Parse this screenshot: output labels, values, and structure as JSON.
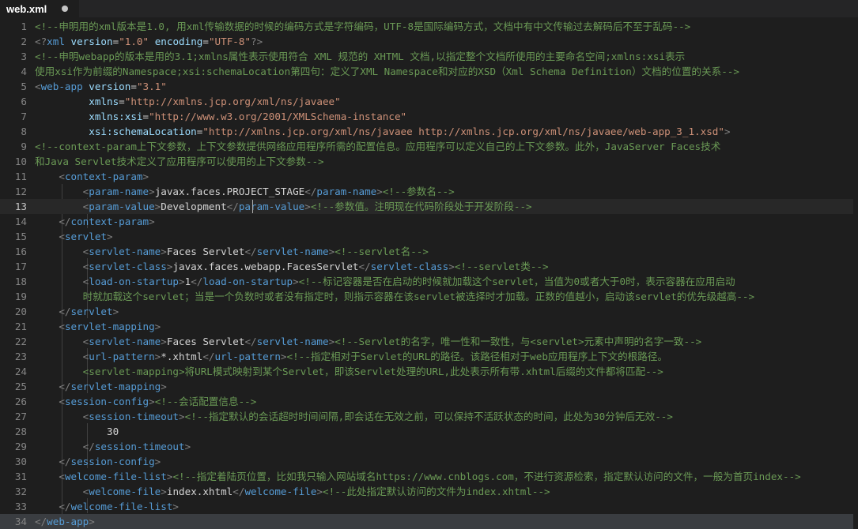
{
  "tab": {
    "title": "web.xml",
    "modified": true
  },
  "editor": {
    "current_line": 13,
    "lines": [
      {
        "n": "1",
        "segs": [
          {
            "c": "cmt",
            "t": "<!--申明用的xml版本是1.0, 用xml传输数据的时候的编码方式是字符编码，UTF-8是国际编码方式，文档中有中文传输过去解码后不至于乱码-->"
          }
        ]
      },
      {
        "n": "2",
        "segs": [
          {
            "c": "punc",
            "t": "<?"
          },
          {
            "c": "tag",
            "t": "xml"
          },
          {
            "c": "txt",
            "t": " "
          },
          {
            "c": "attr",
            "t": "version"
          },
          {
            "c": "txt",
            "t": "="
          },
          {
            "c": "str",
            "t": "\"1.0\""
          },
          {
            "c": "txt",
            "t": " "
          },
          {
            "c": "attr",
            "t": "encoding"
          },
          {
            "c": "txt",
            "t": "="
          },
          {
            "c": "str",
            "t": "\"UTF-8\""
          },
          {
            "c": "punc",
            "t": "?>"
          }
        ]
      },
      {
        "n": "3",
        "segs": [
          {
            "c": "cmt",
            "t": "<!--申明webapp的版本是用的3.1;xmlns属性表示使用符合 XML 规范的 XHTML 文档,以指定整个文档所使用的主要命名空间;xmlns:xsi表示"
          }
        ]
      },
      {
        "n": "4",
        "segs": [
          {
            "c": "cmt",
            "t": "使用xsi作为前缀的Namespace;xsi:schemaLocation第四句：定义了XML Namespace和对应的XSD（Xml Schema Definition）文档的位置的关系-->"
          }
        ]
      },
      {
        "n": "5",
        "segs": [
          {
            "c": "punc",
            "t": "<"
          },
          {
            "c": "tag",
            "t": "web-app"
          },
          {
            "c": "txt",
            "t": " "
          },
          {
            "c": "attr",
            "t": "version"
          },
          {
            "c": "txt",
            "t": "="
          },
          {
            "c": "str",
            "t": "\"3.1\""
          }
        ]
      },
      {
        "n": "6",
        "segs": [
          {
            "c": "txt",
            "t": "         "
          },
          {
            "c": "attr",
            "t": "xmlns"
          },
          {
            "c": "txt",
            "t": "="
          },
          {
            "c": "str",
            "t": "\"http://xmlns.jcp.org/xml/ns/javaee\""
          }
        ]
      },
      {
        "n": "7",
        "segs": [
          {
            "c": "txt",
            "t": "         "
          },
          {
            "c": "attr",
            "t": "xmlns:xsi"
          },
          {
            "c": "txt",
            "t": "="
          },
          {
            "c": "str",
            "t": "\"http://www.w3.org/2001/XMLSchema-instance\""
          }
        ]
      },
      {
        "n": "8",
        "segs": [
          {
            "c": "txt",
            "t": "         "
          },
          {
            "c": "attr",
            "t": "xsi:schemaLocation"
          },
          {
            "c": "txt",
            "t": "="
          },
          {
            "c": "str",
            "t": "\"http://xmlns.jcp.org/xml/ns/javaee http://xmlns.jcp.org/xml/ns/javaee/web-app_3_1.xsd\""
          },
          {
            "c": "punc",
            "t": ">"
          }
        ]
      },
      {
        "n": "9",
        "segs": [
          {
            "c": "cmt",
            "t": "<!--context-param上下文参数，上下文参数提供网络应用程序所需的配置信息。应用程序可以定义自己的上下文参数。此外，JavaServer Faces技术"
          }
        ]
      },
      {
        "n": "10",
        "segs": [
          {
            "c": "cmt",
            "t": "和Java Servlet技术定义了应用程序可以使用的上下文参数-->"
          }
        ]
      },
      {
        "n": "11",
        "segs": [
          {
            "c": "txt",
            "t": "    "
          },
          {
            "c": "punc",
            "t": "<"
          },
          {
            "c": "tag",
            "t": "context-param"
          },
          {
            "c": "punc",
            "t": ">"
          }
        ]
      },
      {
        "n": "12",
        "segs": [
          {
            "c": "txt",
            "t": "        "
          },
          {
            "c": "punc",
            "t": "<"
          },
          {
            "c": "tag",
            "t": "param-name"
          },
          {
            "c": "punc",
            "t": ">"
          },
          {
            "c": "txt",
            "t": "javax.faces.PROJECT_STAGE"
          },
          {
            "c": "punc",
            "t": "</"
          },
          {
            "c": "tag",
            "t": "param-name"
          },
          {
            "c": "punc",
            "t": ">"
          },
          {
            "c": "cmt",
            "t": "<!--参数名-->"
          }
        ]
      },
      {
        "n": "13",
        "segs": [
          {
            "c": "txt",
            "t": "        "
          },
          {
            "c": "punc",
            "t": "<"
          },
          {
            "c": "tag",
            "t": "param-value"
          },
          {
            "c": "punc",
            "t": ">"
          },
          {
            "c": "txt",
            "t": "Development"
          },
          {
            "c": "punc",
            "t": "</"
          },
          {
            "c": "tag",
            "t": "param-value"
          },
          {
            "c": "punc",
            "t": ">"
          },
          {
            "c": "cmt",
            "t": "<!--参数值。注明现在代码阶段处于开发阶段-->"
          }
        ]
      },
      {
        "n": "14",
        "segs": [
          {
            "c": "txt",
            "t": "    "
          },
          {
            "c": "punc",
            "t": "</"
          },
          {
            "c": "tag",
            "t": "context-param"
          },
          {
            "c": "punc",
            "t": ">"
          }
        ]
      },
      {
        "n": "15",
        "segs": [
          {
            "c": "txt",
            "t": "    "
          },
          {
            "c": "punc",
            "t": "<"
          },
          {
            "c": "tag",
            "t": "servlet"
          },
          {
            "c": "punc",
            "t": ">"
          }
        ]
      },
      {
        "n": "16",
        "segs": [
          {
            "c": "txt",
            "t": "        "
          },
          {
            "c": "punc",
            "t": "<"
          },
          {
            "c": "tag",
            "t": "servlet-name"
          },
          {
            "c": "punc",
            "t": ">"
          },
          {
            "c": "txt",
            "t": "Faces Servlet"
          },
          {
            "c": "punc",
            "t": "</"
          },
          {
            "c": "tag",
            "t": "servlet-name"
          },
          {
            "c": "punc",
            "t": ">"
          },
          {
            "c": "cmt",
            "t": "<!--servlet名-->"
          }
        ]
      },
      {
        "n": "17",
        "segs": [
          {
            "c": "txt",
            "t": "        "
          },
          {
            "c": "punc",
            "t": "<"
          },
          {
            "c": "tag",
            "t": "servlet-class"
          },
          {
            "c": "punc",
            "t": ">"
          },
          {
            "c": "txt",
            "t": "javax.faces.webapp.FacesServlet"
          },
          {
            "c": "punc",
            "t": "</"
          },
          {
            "c": "tag",
            "t": "servlet-class"
          },
          {
            "c": "punc",
            "t": ">"
          },
          {
            "c": "cmt",
            "t": "<!--servlet类-->"
          }
        ]
      },
      {
        "n": "18",
        "segs": [
          {
            "c": "txt",
            "t": "        "
          },
          {
            "c": "punc",
            "t": "<"
          },
          {
            "c": "tag",
            "t": "load-on-startup"
          },
          {
            "c": "punc",
            "t": ">"
          },
          {
            "c": "txt",
            "t": "1"
          },
          {
            "c": "punc",
            "t": "</"
          },
          {
            "c": "tag",
            "t": "load-on-startup"
          },
          {
            "c": "punc",
            "t": ">"
          },
          {
            "c": "cmt",
            "t": "<!--标记容器是否在启动的时候就加载这个servlet，当值为0或者大于0时，表示容器在应用启动"
          }
        ]
      },
      {
        "n": "19",
        "segs": [
          {
            "c": "cmt",
            "t": "        时就加载这个servlet；当是一个负数时或者没有指定时，则指示容器在该servlet被选择时才加载。正数的值越小，启动该servlet的优先级越高-->"
          }
        ]
      },
      {
        "n": "20",
        "segs": [
          {
            "c": "txt",
            "t": "    "
          },
          {
            "c": "punc",
            "t": "</"
          },
          {
            "c": "tag",
            "t": "servlet"
          },
          {
            "c": "punc",
            "t": ">"
          }
        ]
      },
      {
        "n": "21",
        "segs": [
          {
            "c": "txt",
            "t": "    "
          },
          {
            "c": "punc",
            "t": "<"
          },
          {
            "c": "tag",
            "t": "servlet-mapping"
          },
          {
            "c": "punc",
            "t": ">"
          }
        ]
      },
      {
        "n": "22",
        "segs": [
          {
            "c": "txt",
            "t": "        "
          },
          {
            "c": "punc",
            "t": "<"
          },
          {
            "c": "tag",
            "t": "servlet-name"
          },
          {
            "c": "punc",
            "t": ">"
          },
          {
            "c": "txt",
            "t": "Faces Servlet"
          },
          {
            "c": "punc",
            "t": "</"
          },
          {
            "c": "tag",
            "t": "servlet-name"
          },
          {
            "c": "punc",
            "t": ">"
          },
          {
            "c": "cmt",
            "t": "<!--Servlet的名字，唯一性和一致性，与<servlet>元素中声明的名字一致-->"
          }
        ]
      },
      {
        "n": "23",
        "segs": [
          {
            "c": "txt",
            "t": "        "
          },
          {
            "c": "punc",
            "t": "<"
          },
          {
            "c": "tag",
            "t": "url-pattern"
          },
          {
            "c": "punc",
            "t": ">"
          },
          {
            "c": "txt",
            "t": "*.xhtml"
          },
          {
            "c": "punc",
            "t": "</"
          },
          {
            "c": "tag",
            "t": "url-pattern"
          },
          {
            "c": "punc",
            "t": ">"
          },
          {
            "c": "cmt",
            "t": "<!--指定相对于Servlet的URL的路径。该路径相对于web应用程序上下文的根路径。"
          }
        ]
      },
      {
        "n": "24",
        "segs": [
          {
            "c": "cmt",
            "t": "        <servlet-mapping>将URL模式映射到某个Servlet，即该Servlet处理的URL,此处表示所有带.xhtml后缀的文件都将匹配-->"
          }
        ]
      },
      {
        "n": "25",
        "segs": [
          {
            "c": "txt",
            "t": "    "
          },
          {
            "c": "punc",
            "t": "</"
          },
          {
            "c": "tag",
            "t": "servlet-mapping"
          },
          {
            "c": "punc",
            "t": ">"
          }
        ]
      },
      {
        "n": "26",
        "segs": [
          {
            "c": "txt",
            "t": "    "
          },
          {
            "c": "punc",
            "t": "<"
          },
          {
            "c": "tag",
            "t": "session-config"
          },
          {
            "c": "punc",
            "t": ">"
          },
          {
            "c": "cmt",
            "t": "<!--会话配置信息-->"
          }
        ]
      },
      {
        "n": "27",
        "segs": [
          {
            "c": "txt",
            "t": "        "
          },
          {
            "c": "punc",
            "t": "<"
          },
          {
            "c": "tag",
            "t": "session-timeout"
          },
          {
            "c": "punc",
            "t": ">"
          },
          {
            "c": "cmt",
            "t": "<!--指定默认的会话超时时间间隔,即会话在无效之前，可以保持不活跃状态的时间，此处为30分钟后无效-->"
          }
        ]
      },
      {
        "n": "28",
        "segs": [
          {
            "c": "txt",
            "t": "            30"
          }
        ]
      },
      {
        "n": "29",
        "segs": [
          {
            "c": "txt",
            "t": "        "
          },
          {
            "c": "punc",
            "t": "</"
          },
          {
            "c": "tag",
            "t": "session-timeout"
          },
          {
            "c": "punc",
            "t": ">"
          }
        ]
      },
      {
        "n": "30",
        "segs": [
          {
            "c": "txt",
            "t": "    "
          },
          {
            "c": "punc",
            "t": "</"
          },
          {
            "c": "tag",
            "t": "session-config"
          },
          {
            "c": "punc",
            "t": ">"
          }
        ]
      },
      {
        "n": "31",
        "segs": [
          {
            "c": "txt",
            "t": "    "
          },
          {
            "c": "punc",
            "t": "<"
          },
          {
            "c": "tag",
            "t": "welcome-file-list"
          },
          {
            "c": "punc",
            "t": ">"
          },
          {
            "c": "cmt",
            "t": "<!--指定着陆页位置，比如我只输入网站域名https://www.cnblogs.com，不进行资源检索，指定默认访问的文件，一般为首页index-->"
          }
        ]
      },
      {
        "n": "32",
        "segs": [
          {
            "c": "txt",
            "t": "        "
          },
          {
            "c": "punc",
            "t": "<"
          },
          {
            "c": "tag",
            "t": "welcome-file"
          },
          {
            "c": "punc",
            "t": ">"
          },
          {
            "c": "txt",
            "t": "index.xhtml"
          },
          {
            "c": "punc",
            "t": "</"
          },
          {
            "c": "tag",
            "t": "welcome-file"
          },
          {
            "c": "punc",
            "t": ">"
          },
          {
            "c": "cmt",
            "t": "<!--此处指定默认访问的文件为index.xhtml-->"
          }
        ]
      },
      {
        "n": "33",
        "segs": [
          {
            "c": "txt",
            "t": "    "
          },
          {
            "c": "punc",
            "t": "</"
          },
          {
            "c": "tag",
            "t": "welcome-file-list"
          },
          {
            "c": "punc",
            "t": ">"
          }
        ]
      },
      {
        "n": "34",
        "segs": [
          {
            "c": "punc",
            "t": "</"
          },
          {
            "c": "tag",
            "t": "web-app"
          },
          {
            "c": "punc",
            "t": ">"
          }
        ]
      }
    ]
  },
  "colors": {
    "background": "#1e1e1e",
    "tabbar": "#252526",
    "comment": "#6a9955",
    "tag": "#569cd6",
    "attribute": "#9cdcfe",
    "string": "#ce9178",
    "text": "#d4d4d4",
    "line_number": "#858585"
  }
}
